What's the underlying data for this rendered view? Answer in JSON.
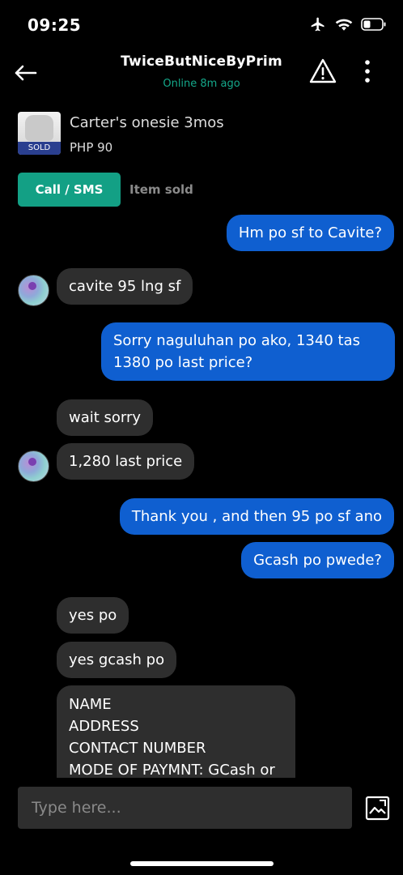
{
  "status_bar": {
    "time": "09:25"
  },
  "header": {
    "title": "TwiceButNiceByPrim",
    "status": "Online 8m ago"
  },
  "item": {
    "name": "Carter's onesie 3mos",
    "price": "PHP 90",
    "sold_tag": "SOLD"
  },
  "actions": {
    "call_label": "Call / SMS",
    "item_status": "Item sold"
  },
  "messages": [
    {
      "side": "sent",
      "text": "Hm po sf to Cavite?"
    },
    {
      "side": "received",
      "text": "cavite 95 lng sf"
    },
    {
      "side": "sent",
      "text": "Sorry naguluhan po ako, 1340 tas 1380 po last price?"
    },
    {
      "side": "received",
      "text": "wait sorry"
    },
    {
      "side": "received",
      "text": "1,280 last price"
    },
    {
      "side": "sent",
      "text": "Thank you , and then 95 po sf ano"
    },
    {
      "side": "sent",
      "text": "Gcash po pwede?"
    },
    {
      "side": "received",
      "text": "yes po"
    },
    {
      "side": "received",
      "text": "yes gcash po"
    },
    {
      "side": "received",
      "lines": [
        "NAME",
        "ADDRESS",
        "CONTACT NUMBER",
        "MODE OF PAYMNT: GCash or"
      ]
    }
  ],
  "composer": {
    "placeholder": "Type here..."
  },
  "colors": {
    "accent": "#13a085",
    "sent_bubble": "#0f5fd0",
    "received_bubble": "#2e2e2e",
    "online": "#14a88a"
  },
  "icons": [
    "airplane-icon",
    "wifi-icon",
    "battery-icon",
    "back-arrow-icon",
    "warning-icon",
    "more-vertical-icon",
    "gallery-icon"
  ]
}
